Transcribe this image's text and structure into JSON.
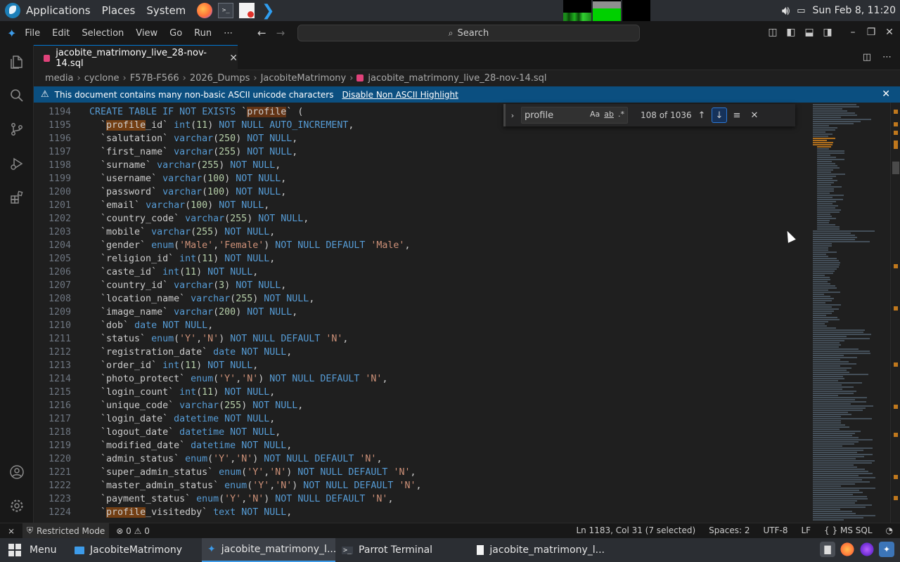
{
  "os_panel": {
    "menus": [
      "Applications",
      "Places",
      "System"
    ],
    "clock": "Sun Feb 8, 11:20"
  },
  "titlebar": {
    "menus": [
      "File",
      "Edit",
      "Selection",
      "View",
      "Go",
      "Run",
      "⋯"
    ],
    "search": "Search"
  },
  "tab": {
    "label": "jacobite_matrimony_live_28-nov-14.sql"
  },
  "breadcrumb": [
    "media",
    "cyclone",
    "F57B-F566",
    "2026_Dumps",
    "JacobiteMatrimony",
    "jacobite_matrimony_live_28-nov-14.sql"
  ],
  "banner": {
    "message": "This document contains many non-basic ASCII unicode characters",
    "action": "Disable Non ASCII Highlight"
  },
  "find": {
    "query": "profile",
    "opt_case": "Aa",
    "opt_word": "ab",
    "opt_regex": ".*",
    "count": "108 of 1036"
  },
  "editor_lines": [
    {
      "n": "1194",
      "t": "CREATE TABLE IF NOT EXISTS `profile` ("
    },
    {
      "n": "1195",
      "t": "  `profile_id` int(11) NOT NULL AUTO_INCREMENT,"
    },
    {
      "n": "1196",
      "t": "  `salutation` varchar(250) NOT NULL,"
    },
    {
      "n": "1197",
      "t": "  `first_name` varchar(255) NOT NULL,"
    },
    {
      "n": "1198",
      "t": "  `surname` varchar(255) NOT NULL,"
    },
    {
      "n": "1199",
      "t": "  `username` varchar(100) NOT NULL,"
    },
    {
      "n": "1200",
      "t": "  `password` varchar(100) NOT NULL,"
    },
    {
      "n": "1201",
      "t": "  `email` varchar(100) NOT NULL,"
    },
    {
      "n": "1202",
      "t": "  `country_code` varchar(255) NOT NULL,"
    },
    {
      "n": "1203",
      "t": "  `mobile` varchar(255) NOT NULL,"
    },
    {
      "n": "1204",
      "t": "  `gender` enum('Male','Female') NOT NULL DEFAULT 'Male',"
    },
    {
      "n": "1205",
      "t": "  `religion_id` int(11) NOT NULL,"
    },
    {
      "n": "1206",
      "t": "  `caste_id` int(11) NOT NULL,"
    },
    {
      "n": "1207",
      "t": "  `country_id` varchar(3) NOT NULL,"
    },
    {
      "n": "1208",
      "t": "  `location_name` varchar(255) NOT NULL,"
    },
    {
      "n": "1209",
      "t": "  `image_name` varchar(200) NOT NULL,"
    },
    {
      "n": "1210",
      "t": "  `dob` date NOT NULL,"
    },
    {
      "n": "1211",
      "t": "  `status` enum('Y','N') NOT NULL DEFAULT 'N',"
    },
    {
      "n": "1212",
      "t": "  `registration_date` date NOT NULL,"
    },
    {
      "n": "1213",
      "t": "  `order_id` int(11) NOT NULL,"
    },
    {
      "n": "1214",
      "t": "  `photo_protect` enum('Y','N') NOT NULL DEFAULT 'N',"
    },
    {
      "n": "1215",
      "t": "  `login_count` int(11) NOT NULL,"
    },
    {
      "n": "1216",
      "t": "  `unique_code` varchar(255) NOT NULL,"
    },
    {
      "n": "1217",
      "t": "  `login_date` datetime NOT NULL,"
    },
    {
      "n": "1218",
      "t": "  `logout_date` datetime NOT NULL,"
    },
    {
      "n": "1219",
      "t": "  `modified_date` datetime NOT NULL,"
    },
    {
      "n": "1220",
      "t": "  `admin_status` enum('Y','N') NOT NULL DEFAULT 'N',"
    },
    {
      "n": "1221",
      "t": "  `super_admin_status` enum('Y','N') NOT NULL DEFAULT 'N',"
    },
    {
      "n": "1222",
      "t": "  `master_admin_status` enum('Y','N') NOT NULL DEFAULT 'N',"
    },
    {
      "n": "1223",
      "t": "  `payment_status` enum('Y','N') NOT NULL DEFAULT 'N',"
    },
    {
      "n": "1224",
      "t": "  `profile_visitedby` text NOT NULL,"
    }
  ],
  "statusbar": {
    "restricted": "Restricted Mode",
    "errors": "0",
    "warnings": "0",
    "position": "Ln 1183, Col 31 (7 selected)",
    "spaces": "Spaces: 2",
    "encoding": "UTF-8",
    "eol": "LF",
    "language": "MS SQL"
  },
  "taskbar": {
    "menu": "Menu",
    "tasks": [
      "JacobiteMatrimony",
      "jacobite_matrimony_l...",
      "Parrot Terminal",
      "jacobite_matrimony_l..."
    ]
  },
  "colors": {
    "accent": "#0078d4",
    "banner": "#0b4f80",
    "keyword": "#569cd6",
    "string": "#ce9178",
    "number": "#b5cea8",
    "match_highlight": "#623315"
  }
}
